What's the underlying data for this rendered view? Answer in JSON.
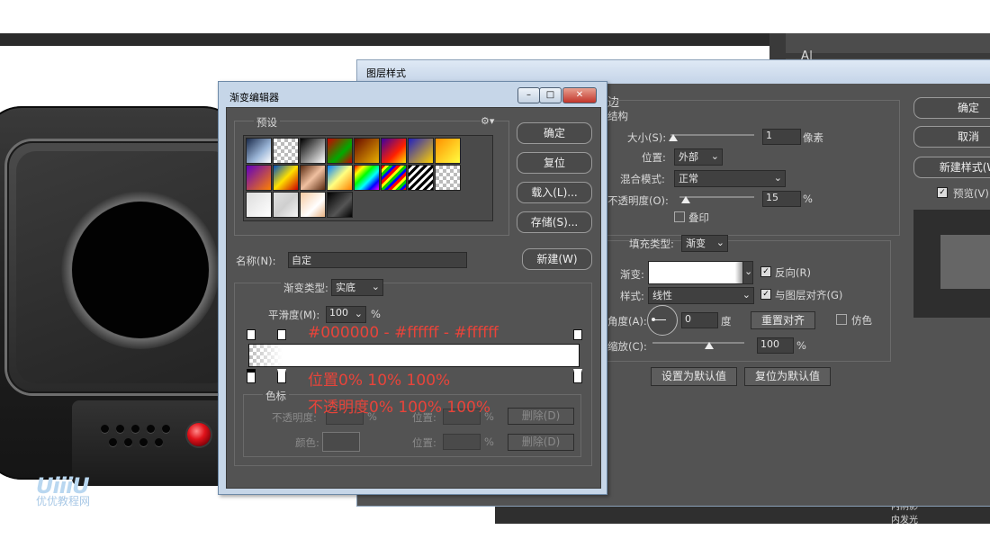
{
  "layer_style": {
    "title": "图层样式",
    "section_partial": "边",
    "structure_label": "结构",
    "size_label": "大小(S):",
    "size_value": "1",
    "size_unit": "像素",
    "position_label": "位置:",
    "position_value": "外部",
    "blend_label": "混合模式:",
    "blend_value": "正常",
    "opacity_label": "不透明度(O):",
    "opacity_value": "15",
    "opacity_unit": "%",
    "overprint_label": "叠印",
    "fill_type_label": "填充类型:",
    "fill_type_value": "渐变",
    "gradient_label": "渐变:",
    "reverse_label": "反向(R)",
    "style_label": "样式:",
    "style_value": "线性",
    "align_label": "与图层对齐(G)",
    "angle_label": "角度(A):",
    "angle_value": "0",
    "angle_unit": "度",
    "reset_align": "重置对齐",
    "dither_label": "仿色",
    "scale_label": "缩放(C):",
    "scale_value": "100",
    "scale_unit": "%",
    "set_default": "设置为默认值",
    "reset_default": "复位为默认值",
    "ok": "确定",
    "cancel": "取消",
    "new_style": "新建样式(W",
    "preview": "预览(V)",
    "side_partial_1": "内阴影",
    "side_partial_2": "内发光"
  },
  "gradient_editor": {
    "title": "渐变编辑器",
    "presets_label": "预设",
    "ok": "确定",
    "reset": "复位",
    "load": "载入(L)...",
    "save": "存储(S)...",
    "name_label": "名称(N):",
    "name_value": "自定",
    "new_button": "新建(W)",
    "type_label": "渐变类型:",
    "type_value": "实底",
    "smooth_label": "平滑度(M):",
    "smooth_value": "100",
    "smooth_unit": "%",
    "stops_label": "色标",
    "stop_opacity_label": "不透明度:",
    "stop_position_label": "位置:",
    "stop_color_label": "颜色:",
    "percent": "%",
    "delete_label": "删除(D)"
  },
  "annotations": {
    "colors": "#000000 - #ffffff - #ffffff",
    "positions": "位置0% 10% 100%",
    "opacities": "不透明度0% 100% 100%"
  },
  "watermark": {
    "brand": "UiiiU",
    "sub": "优优教程网"
  },
  "right_panel_glyph": "A|"
}
